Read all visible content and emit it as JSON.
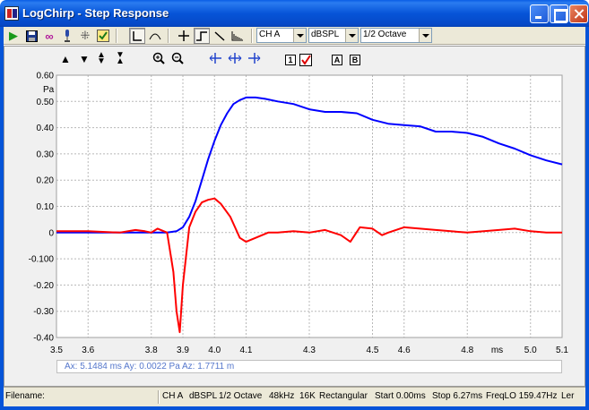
{
  "window": {
    "title": "LogChirp - Step Response"
  },
  "toolbar": {
    "channel": "CH A",
    "units": "dBSPL",
    "smoothing": "1/2 Octave"
  },
  "plot_toolbar": {
    "box1": "1",
    "boxA": "A",
    "boxB": "B"
  },
  "readout": {
    "text": "Ax: 5.1484 ms  Ay: 0.0022 Pa  Az: 1.7711 m"
  },
  "status": {
    "filename_label": "Filename:",
    "channel": "CH A",
    "units": "dBSPL",
    "smoothing": "1/2 Octave",
    "rate": "48kHz",
    "size": "16K",
    "window": "Rectangular",
    "start": "Start 0.00ms",
    "stop": "Stop 6.27ms",
    "freqlo": "FreqLO 159.47Hz",
    "trailing": "Ler"
  },
  "chart_data": {
    "type": "line",
    "ylabel": "Pa",
    "xlabel": "ms",
    "xlim": [
      3.5,
      5.1
    ],
    "ylim": [
      -0.4,
      0.6
    ],
    "x_ticks": [
      "3.5",
      "3.6",
      "3.8",
      "3.9",
      "4.0",
      "4.1",
      "4.3",
      "4.5",
      "4.6",
      "4.8",
      "5.0",
      "5.1"
    ],
    "x_tick_values": [
      3.5,
      3.6,
      3.8,
      3.9,
      4.0,
      4.1,
      4.3,
      4.5,
      4.6,
      4.8,
      5.0,
      5.1
    ],
    "y_ticks": [
      "0.60",
      "0.50",
      "0.40",
      "0.30",
      "0.20",
      "0.10",
      "0",
      "-0.100",
      "-0.20",
      "-0.30",
      "-0.40"
    ],
    "y_tick_values": [
      0.6,
      0.5,
      0.4,
      0.3,
      0.2,
      0.1,
      0,
      -0.1,
      -0.2,
      -0.3,
      -0.4
    ],
    "grid": true,
    "series": [
      {
        "color": "#0000ff",
        "x": [
          3.5,
          3.6,
          3.7,
          3.8,
          3.85,
          3.88,
          3.9,
          3.92,
          3.94,
          3.96,
          3.98,
          4.0,
          4.02,
          4.04,
          4.06,
          4.08,
          4.1,
          4.13,
          4.16,
          4.2,
          4.25,
          4.3,
          4.35,
          4.4,
          4.45,
          4.5,
          4.55,
          4.6,
          4.65,
          4.7,
          4.75,
          4.8,
          4.85,
          4.9,
          4.95,
          5.0,
          5.05,
          5.1
        ],
        "y": [
          0.0,
          0.0,
          0.0,
          0.0,
          0.0,
          0.005,
          0.02,
          0.06,
          0.12,
          0.2,
          0.28,
          0.35,
          0.41,
          0.455,
          0.49,
          0.505,
          0.515,
          0.515,
          0.51,
          0.5,
          0.49,
          0.47,
          0.46,
          0.46,
          0.455,
          0.43,
          0.415,
          0.41,
          0.405,
          0.385,
          0.385,
          0.38,
          0.365,
          0.34,
          0.32,
          0.295,
          0.275,
          0.26
        ]
      },
      {
        "color": "#ff0000",
        "x": [
          3.5,
          3.6,
          3.7,
          3.75,
          3.78,
          3.8,
          3.82,
          3.85,
          3.87,
          3.88,
          3.89,
          3.9,
          3.92,
          3.94,
          3.96,
          3.98,
          4.0,
          4.02,
          4.05,
          4.08,
          4.1,
          4.13,
          4.17,
          4.2,
          4.25,
          4.3,
          4.35,
          4.4,
          4.43,
          4.46,
          4.5,
          4.53,
          4.55,
          4.6,
          4.65,
          4.7,
          4.8,
          4.9,
          4.95,
          5.0,
          5.05,
          5.1
        ],
        "y": [
          0.005,
          0.005,
          0.0,
          0.01,
          0.005,
          0.0,
          0.015,
          0.0,
          -0.15,
          -0.3,
          -0.38,
          -0.2,
          0.02,
          0.08,
          0.115,
          0.125,
          0.13,
          0.11,
          0.06,
          -0.02,
          -0.035,
          -0.02,
          0.0,
          0.0,
          0.005,
          0.0,
          0.01,
          -0.01,
          -0.035,
          0.02,
          0.015,
          -0.01,
          0.0,
          0.02,
          0.015,
          0.01,
          0.0,
          0.01,
          0.015,
          0.005,
          0.0,
          0.0
        ]
      }
    ]
  }
}
